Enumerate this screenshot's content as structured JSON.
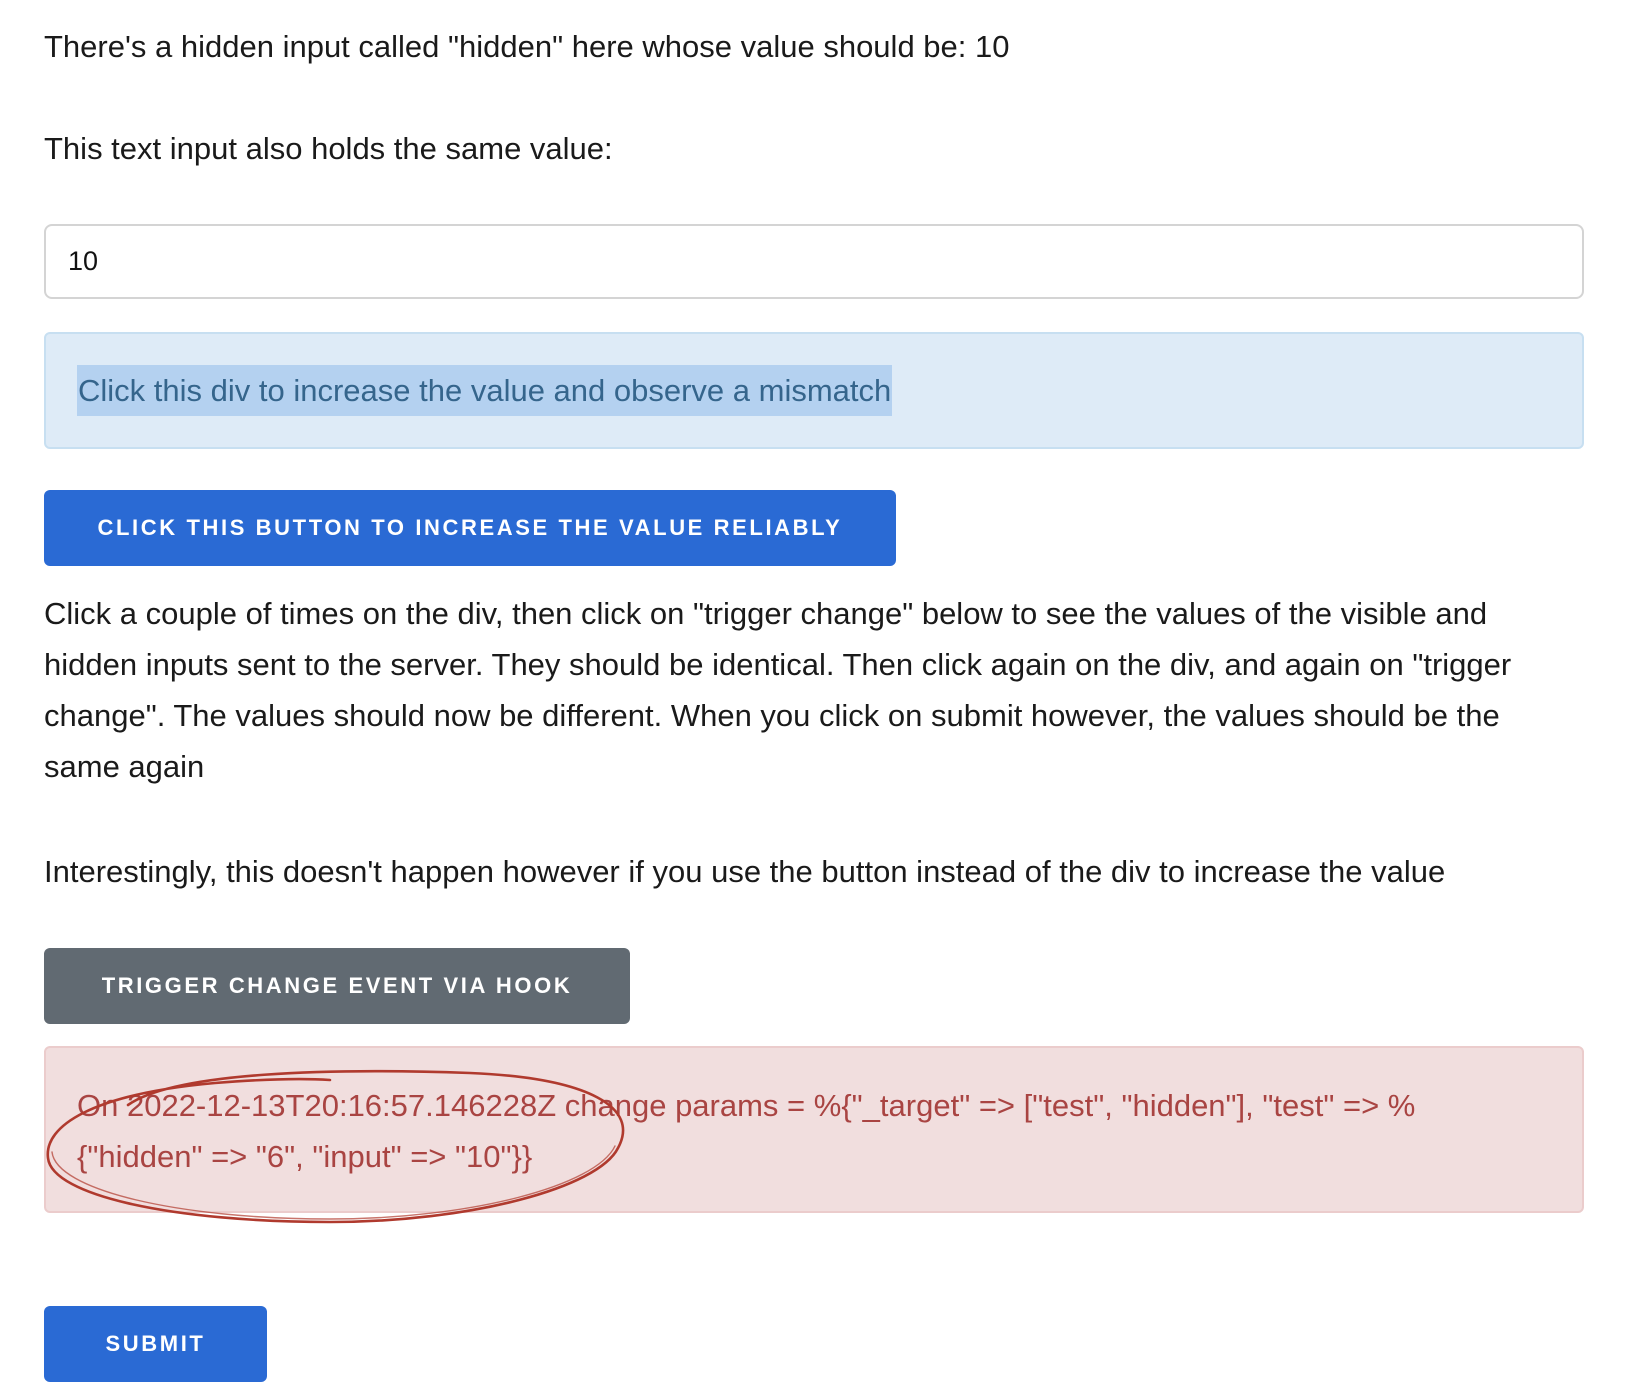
{
  "intro_text": "There's a hidden input called \"hidden\" here whose value should be: 10",
  "same_value_text": "This text input also holds the same value:",
  "text_input": {
    "value": "10"
  },
  "mismatch_div": {
    "label": "Click this div to increase the value and observe a mismatch"
  },
  "increase_button": {
    "label": "CLICK THIS BUTTON TO INCREASE THE VALUE RELIABLY"
  },
  "explanation_text": "Click a couple of times on the div, then click on \"trigger change\" below to see the values of the visible and hidden inputs sent to the server. They should be identical. Then click again on the div, and again on \"trigger change\". The values should now be different. When you click on submit however, the values should be the same again",
  "interesting_text": "Interestingly, this doesn't happen however if you use the button instead of the div to increase the value",
  "trigger_button": {
    "label": "TRIGGER CHANGE EVENT VIA HOOK"
  },
  "alert": {
    "message": "On 2022-12-13T20:16:57.146228Z change params = %{\"_target\" => [\"test\", \"hidden\"], \"test\" => %{\"hidden\" => \"6\", \"input\" => \"10\"}}"
  },
  "submit_button": {
    "label": "SUBMIT"
  },
  "colors": {
    "primary_button": "#2a6ad4",
    "secondary_button": "#616a72",
    "info_background": "#deebf7",
    "selection_highlight": "#b4d1f0",
    "alert_background": "#f1dede",
    "alert_text": "#a94442",
    "annotation_ellipse": "#b03a2e"
  }
}
